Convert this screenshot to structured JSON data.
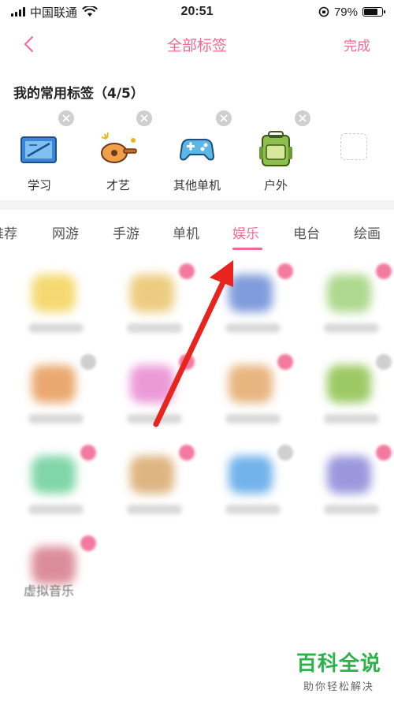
{
  "status_bar": {
    "carrier": "中国联通",
    "time": "20:51",
    "battery": "79%",
    "battery_level": 0.79
  },
  "nav": {
    "title": "全部标签",
    "done_label": "完成"
  },
  "favorites": {
    "title": "我的常用标签（4/5）",
    "items": [
      {
        "label": "学习",
        "icon": "study-icon"
      },
      {
        "label": "才艺",
        "icon": "guitar-icon"
      },
      {
        "label": "其他单机",
        "icon": "gamepad-icon"
      },
      {
        "label": "户外",
        "icon": "backpack-icon"
      }
    ]
  },
  "tabs": [
    {
      "label": "推荐"
    },
    {
      "label": "网游"
    },
    {
      "label": "手游"
    },
    {
      "label": "单机"
    },
    {
      "label": "娱乐",
      "active": true
    },
    {
      "label": "电台"
    },
    {
      "label": "绘画"
    }
  ],
  "grid": {
    "last_caption": "虚拟音乐"
  },
  "watermark": {
    "title": "百科全说",
    "subtitle": "助你轻松解决"
  },
  "colors": {
    "accent": "#f06b93",
    "arrow": "#e8241f",
    "watermark": "#2bb34a"
  }
}
